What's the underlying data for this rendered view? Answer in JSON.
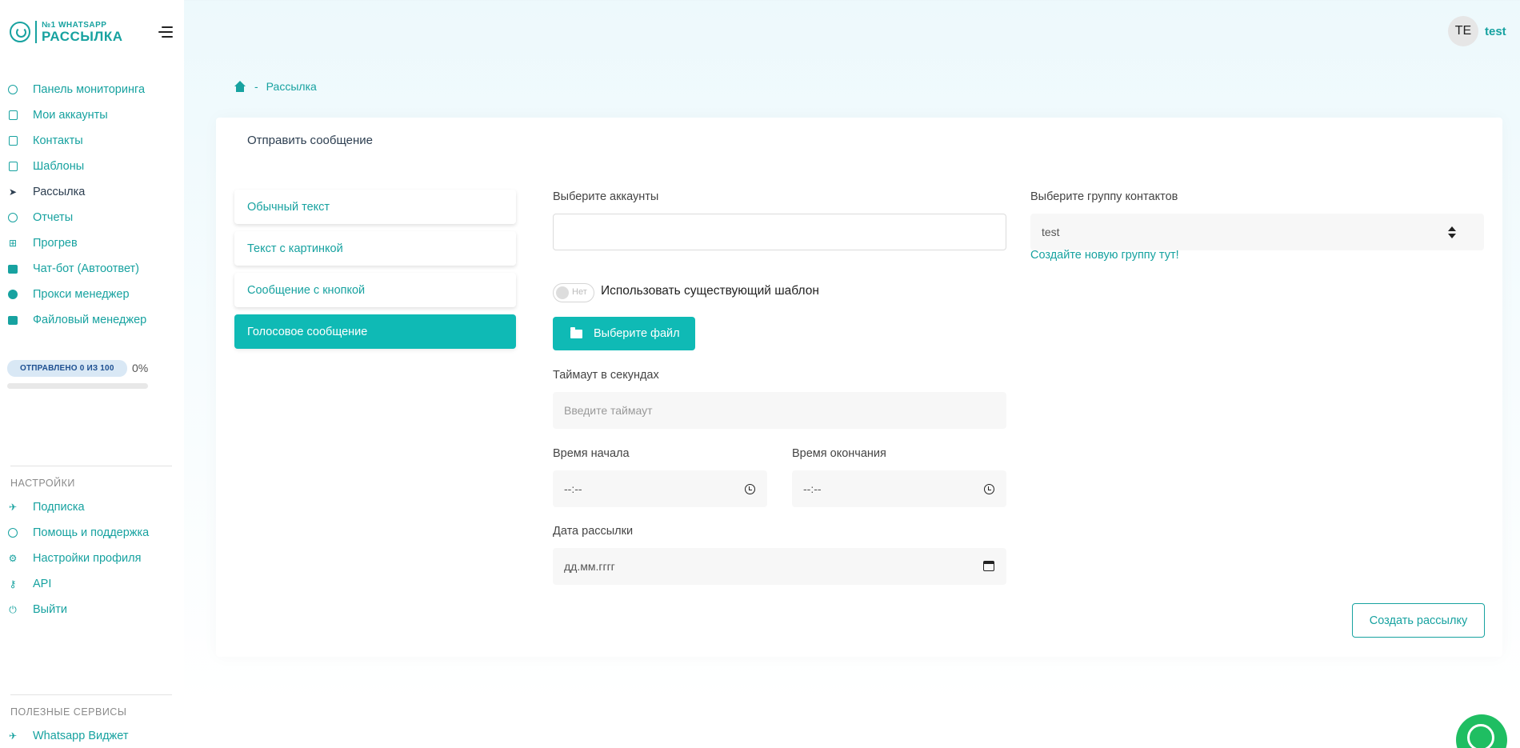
{
  "brand": {
    "logo_top": "№1 WHATSAPP",
    "logo_bottom": "РАССЫЛКА"
  },
  "user": {
    "initials": "TE",
    "name": "test"
  },
  "nav": {
    "items": [
      {
        "label": "Панель мониторинга",
        "icon": "dashboard-icon"
      },
      {
        "label": "Мои аккаунты",
        "icon": "accounts-icon"
      },
      {
        "label": "Контакты",
        "icon": "contacts-icon"
      },
      {
        "label": "Шаблоны",
        "icon": "templates-icon"
      },
      {
        "label": "Рассылка",
        "icon": "send-icon",
        "active": true
      },
      {
        "label": "Отчеты",
        "icon": "reports-icon"
      },
      {
        "label": "Прогрев",
        "icon": "warmup-icon"
      },
      {
        "label": "Чат-бот (Автоответ)",
        "icon": "robot-icon"
      },
      {
        "label": "Прокси менеджер",
        "icon": "proxy-icon"
      },
      {
        "label": "Файловый менеджер",
        "icon": "folder-icon"
      }
    ]
  },
  "progress": {
    "badge": "ОТПРАВЛЕНО 0 ИЗ 100",
    "percent": "0%",
    "fraction": 0
  },
  "settings": {
    "title": "НАСТРОЙКИ",
    "items": [
      {
        "label": "Подписка",
        "icon": "rocket-icon"
      },
      {
        "label": "Помощь и поддержка",
        "icon": "headset-icon"
      },
      {
        "label": "Настройки профиля",
        "icon": "gear-icon"
      },
      {
        "label": "API",
        "icon": "key-icon"
      },
      {
        "label": "Выйти",
        "icon": "power-icon"
      }
    ]
  },
  "services": {
    "title": "ПОЛЕЗНЫЕ СЕРВИСЫ",
    "items": [
      {
        "label": "Whatsapp Виджет",
        "icon": "rocket-icon"
      }
    ]
  },
  "breadcrumb": {
    "current": "Рассылка",
    "separator": "-"
  },
  "card": {
    "title": "Отправить сообщение",
    "tabs": [
      {
        "label": "Обычный текст"
      },
      {
        "label": "Текст с картинкой"
      },
      {
        "label": "Сообщение с кнопкой"
      },
      {
        "label": "Голосовое сообщение",
        "active": true
      }
    ]
  },
  "form": {
    "accounts_label": "Выберите аккаунты",
    "accounts_value": "",
    "template_toggle_state": "Нет",
    "template_toggle_label": "Использовать существующий шаблон",
    "file_button": "Выберите файл",
    "timeout_label": "Таймаут в секундах",
    "timeout_placeholder": "Введите таймаут",
    "start_label": "Время начала",
    "start_value": "--:--",
    "end_label": "Время окончания",
    "end_value": "--:--",
    "date_label": "Дата рассылки",
    "date_value": "дд.мм.гггг",
    "group_label": "Выберите группу контактов",
    "group_value": "test",
    "group_link": "Создайте новую группу тут!",
    "submit": "Создать рассылку"
  }
}
